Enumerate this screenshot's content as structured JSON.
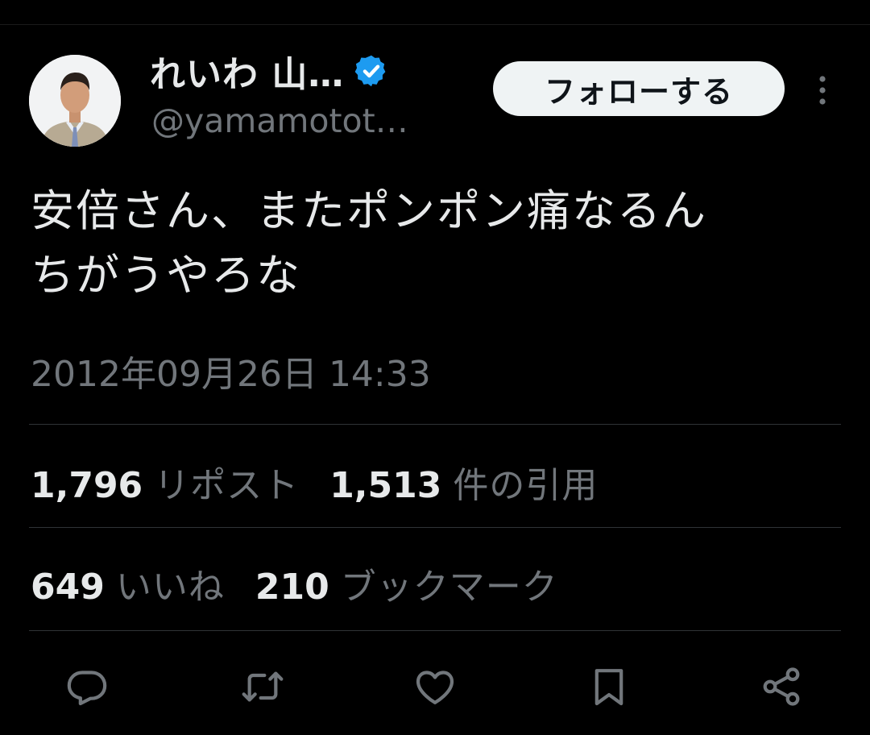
{
  "profile": {
    "name": "れいわ 山…",
    "handle": "@yamamotot…",
    "follow_label": "フォローする"
  },
  "tweet": {
    "line1": "安倍さん、またポンポン痛なるん",
    "line2": "ちがうやろな",
    "timestamp": "2012年09月26日 14:33"
  },
  "stats": {
    "reposts": {
      "count": "1,796",
      "label": "リポスト"
    },
    "quotes": {
      "count": "1,513",
      "label": "件の引用"
    },
    "likes": {
      "count": "649",
      "label": "いいね"
    },
    "bookmarks": {
      "count": "210",
      "label": "ブックマーク"
    }
  },
  "icons": {
    "verified": "verified-badge-icon",
    "more": "more-vertical-icon",
    "reply": "reply-icon",
    "repost": "repost-icon",
    "like": "heart-icon",
    "bookmark": "bookmark-icon",
    "share": "share-icon"
  },
  "colors": {
    "background": "#000000",
    "text_primary": "#e7e9ea",
    "text_secondary": "#71767b",
    "verified_blue": "#1d9bf0",
    "follow_button_bg": "#eff3f4"
  }
}
